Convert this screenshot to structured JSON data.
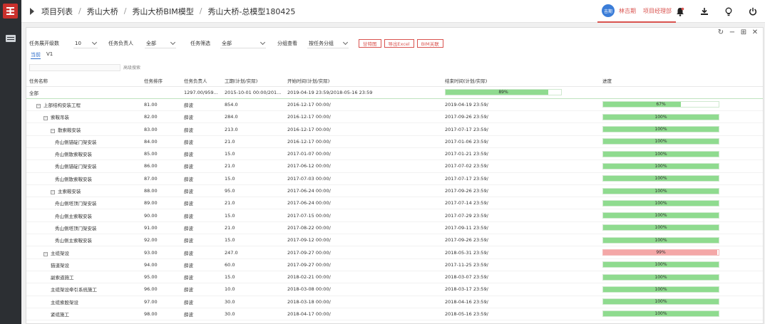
{
  "breadcrumb": [
    "项目列表",
    "秀山大桥",
    "秀山大桥BIM模型",
    "秀山大桥-总模型180425"
  ],
  "user": {
    "avatar_text": "吉期",
    "name": "林吉期",
    "role": "项目经理部"
  },
  "top_icons": [
    "bell-icon",
    "download-icon",
    "bulb-icon",
    "power-icon"
  ],
  "colors": {
    "accent": "#d9534f",
    "progress_green": "#8fdb8f",
    "progress_red": "#f4a7a7",
    "link_blue": "#2a6bc9"
  },
  "toolbar": {
    "level_label": "任务展开级数",
    "level_value": "10",
    "owner_label": "任务负责人",
    "owner_value": "全部",
    "filter_label": "任务筛选",
    "filter_value": "全部",
    "group_label": "分组查看",
    "group_value": "按任务分组",
    "gantt_btn": "甘特图",
    "export_btn": "导出Excel",
    "bim_btn": "BIM关联"
  },
  "tabs": {
    "active": "当前",
    "other": "V1"
  },
  "search": {
    "placeholder": "",
    "advanced": "高级搜索"
  },
  "columns": [
    "任务名称",
    "任务排序",
    "任务负责人",
    "工期(计划/实际)",
    "开始时间(计划/实际)",
    "结束时间(计划/实际)",
    "进度"
  ],
  "rows": [
    {
      "name": "全部",
      "order": "",
      "owner": "",
      "duration": "1297.00/959...",
      "start": "2015-10-01 00:00/201...",
      "end": "2019-04-19 23:59/2018-05-16 23:59",
      "progress": 89,
      "bar_col": "end",
      "level": 0,
      "toggle": ""
    },
    {
      "name": "上部结构安装工程",
      "order": "81.00",
      "owner": "薛波",
      "duration": "854.0",
      "start": "2016-12-17 00:00/",
      "end": "2019-04-19 23:59/",
      "progress": 67,
      "bar_col": "progress",
      "level": 1,
      "toggle": "−"
    },
    {
      "name": "索鞍吊装",
      "order": "82.00",
      "owner": "薛波",
      "duration": "284.0",
      "start": "2016-12-17 00:00/",
      "end": "2017-09-26 23:59/",
      "progress": 100,
      "bar_col": "progress",
      "level": 2,
      "toggle": "−"
    },
    {
      "name": "散索鞍安装",
      "order": "83.00",
      "owner": "薛波",
      "duration": "213.0",
      "start": "2016-12-17 00:00/",
      "end": "2017-07-17 23:59/",
      "progress": 100,
      "bar_col": "progress",
      "level": 3,
      "toggle": "−"
    },
    {
      "name": "舟山侧锚碇门架安装",
      "order": "84.00",
      "owner": "薛波",
      "duration": "21.0",
      "start": "2016-12-17 00:00/",
      "end": "2017-01-06 23:59/",
      "progress": 100,
      "bar_col": "progress",
      "level": 4,
      "toggle": ""
    },
    {
      "name": "舟山侧散索鞍安装",
      "order": "85.00",
      "owner": "薛波",
      "duration": "15.0",
      "start": "2017-01-07 00:00/",
      "end": "2017-01-21 23:59/",
      "progress": 100,
      "bar_col": "progress",
      "level": 4,
      "toggle": ""
    },
    {
      "name": "秀山侧锚碇门架安装",
      "order": "86.00",
      "owner": "薛波",
      "duration": "21.0",
      "start": "2017-06-12 00:00/",
      "end": "2017-07-02 23:59/",
      "progress": 100,
      "bar_col": "progress",
      "level": 4,
      "toggle": ""
    },
    {
      "name": "秀山侧散索鞍安装",
      "order": "87.00",
      "owner": "薛波",
      "duration": "15.0",
      "start": "2017-07-03 00:00/",
      "end": "2017-07-17 23:59/",
      "progress": 100,
      "bar_col": "progress",
      "level": 4,
      "toggle": ""
    },
    {
      "name": "主索鞍安装",
      "order": "88.00",
      "owner": "薛波",
      "duration": "95.0",
      "start": "2017-06-24 00:00/",
      "end": "2017-09-26 23:59/",
      "progress": 100,
      "bar_col": "progress",
      "level": 3,
      "toggle": "−"
    },
    {
      "name": "舟山侧塔顶门架安装",
      "order": "89.00",
      "owner": "薛波",
      "duration": "21.0",
      "start": "2017-06-24 00:00/",
      "end": "2017-07-14 23:59/",
      "progress": 100,
      "bar_col": "progress",
      "level": 4,
      "toggle": ""
    },
    {
      "name": "舟山侧主索鞍安装",
      "order": "90.00",
      "owner": "薛波",
      "duration": "15.0",
      "start": "2017-07-15 00:00/",
      "end": "2017-07-29 23:59/",
      "progress": 100,
      "bar_col": "progress",
      "level": 4,
      "toggle": ""
    },
    {
      "name": "秀山侧塔顶门架安装",
      "order": "91.00",
      "owner": "薛波",
      "duration": "21.0",
      "start": "2017-08-22 00:00/",
      "end": "2017-09-11 23:59/",
      "progress": 100,
      "bar_col": "progress",
      "level": 4,
      "toggle": ""
    },
    {
      "name": "秀山侧主索鞍安装",
      "order": "92.00",
      "owner": "薛波",
      "duration": "15.0",
      "start": "2017-09-12 00:00/",
      "end": "2017-09-26 23:59/",
      "progress": 100,
      "bar_col": "progress",
      "level": 4,
      "toggle": ""
    },
    {
      "name": "主缆架设",
      "order": "93.00",
      "owner": "薛波",
      "duration": "247.0",
      "start": "2017-09-27 00:00/",
      "end": "2018-05-31 23:59/",
      "progress": 99,
      "bar_col": "progress",
      "level": 2,
      "toggle": "−",
      "red": true
    },
    {
      "name": "猫道架设",
      "order": "94.00",
      "owner": "薛波",
      "duration": "60.0",
      "start": "2017-09-27 00:00/",
      "end": "2017-11-25 23:59/",
      "progress": 100,
      "bar_col": "progress",
      "level": 3,
      "toggle": ""
    },
    {
      "name": "副索道施工",
      "order": "95.00",
      "owner": "薛波",
      "duration": "15.0",
      "start": "2018-02-21 00:00/",
      "end": "2018-03-07 23:59/",
      "progress": 100,
      "bar_col": "progress",
      "level": 3,
      "toggle": ""
    },
    {
      "name": "主缆架设牵引系统施工",
      "order": "96.00",
      "owner": "薛波",
      "duration": "10.0",
      "start": "2018-03-08 00:00/",
      "end": "2018-03-17 23:59/",
      "progress": 100,
      "bar_col": "progress",
      "level": 3,
      "toggle": ""
    },
    {
      "name": "主缆索股架设",
      "order": "97.00",
      "owner": "薛波",
      "duration": "30.0",
      "start": "2018-03-18 00:00/",
      "end": "2018-04-16 23:59/",
      "progress": 100,
      "bar_col": "progress",
      "level": 3,
      "toggle": ""
    },
    {
      "name": "紧缆施工",
      "order": "98.00",
      "owner": "薛波",
      "duration": "30.0",
      "start": "2018-04-17 00:00/",
      "end": "2018-05-16 23:59/",
      "progress": 100,
      "bar_col": "progress",
      "level": 3,
      "toggle": ""
    }
  ]
}
